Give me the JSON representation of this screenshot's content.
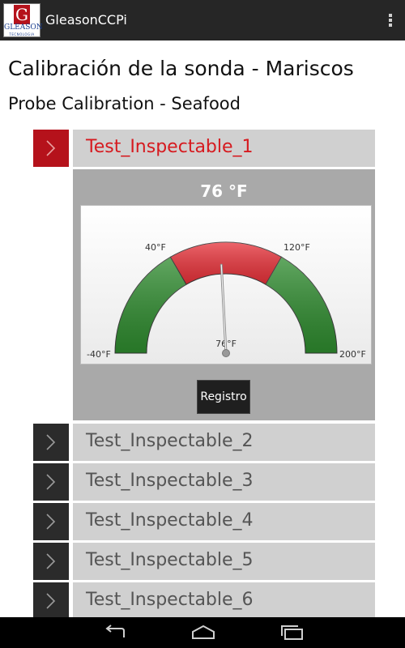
{
  "action_bar": {
    "app_name": "GleasonCCPi",
    "logo": {
      "letter": "G",
      "word": "GLEASON",
      "tagline": "TECNOLOGIA"
    },
    "overflow_icon": "overflow-menu-icon"
  },
  "page": {
    "title_es": "Calibración de la sonda - Mariscos",
    "title_en": "Probe Calibration - Seafood"
  },
  "items": [
    {
      "label": "Test_Inspectable_1",
      "expanded": true
    },
    {
      "label": "Test_Inspectable_2",
      "expanded": false
    },
    {
      "label": "Test_Inspectable_3",
      "expanded": false
    },
    {
      "label": "Test_Inspectable_4",
      "expanded": false
    },
    {
      "label": "Test_Inspectable_5",
      "expanded": false
    },
    {
      "label": "Test_Inspectable_6",
      "expanded": false
    }
  ],
  "gauge": {
    "reading": "76 °F",
    "value": 76,
    "min": -40,
    "max": 200,
    "labels": {
      "min": "-40°F",
      "low": "40°F",
      "high": "120°F",
      "max": "200°F",
      "value": "76°F"
    },
    "zones": [
      {
        "from": -40,
        "to": 40,
        "color": "#2e8b2e"
      },
      {
        "from": 40,
        "to": 120,
        "color": "#e8323a"
      },
      {
        "from": 120,
        "to": 200,
        "color": "#2e8b2e"
      }
    ],
    "button_label": "Registro"
  },
  "nav": {
    "back_icon": "back-icon",
    "home_icon": "home-icon",
    "recents_icon": "recent-apps-icon"
  }
}
